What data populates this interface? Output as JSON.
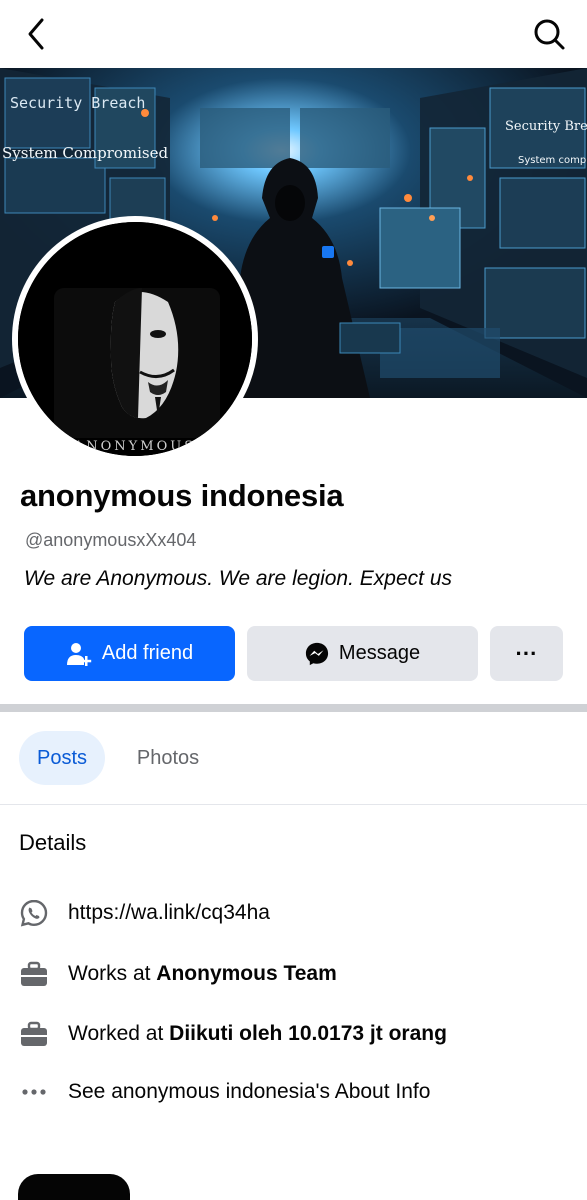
{
  "header": {
    "back_icon": "chevron-left-icon",
    "search_icon": "search-icon"
  },
  "cover": {
    "overlay_texts": [
      "Security Breach",
      "System Compromised",
      "Security Breach",
      "System compromised"
    ]
  },
  "avatar": {
    "mask_text": "ANONYMOUS"
  },
  "profile": {
    "name": "anonymous indonesia",
    "handle": "@anonymousxXx404",
    "bio": "We are Anonymous. We are legion. Expect us"
  },
  "actions": {
    "add_friend": "Add friend",
    "message": "Message",
    "more": "···"
  },
  "tabs": [
    {
      "label": "Posts",
      "active": true
    },
    {
      "label": "Photos",
      "active": false
    }
  ],
  "details": {
    "title": "Details",
    "items": [
      {
        "icon": "whatsapp-icon",
        "text": "https://wa.link/cq34ha"
      },
      {
        "icon": "briefcase-icon",
        "prefix": "Works at ",
        "bold": "Anonymous Team"
      },
      {
        "icon": "briefcase-icon",
        "prefix": "Worked at ",
        "bold": "Diikuti oleh 10.0173 jt orang"
      },
      {
        "icon": "more-dots-icon",
        "text": "See anonymous indonesia's About Info"
      }
    ]
  },
  "colors": {
    "primary": "#0866ff",
    "secondary_button": "#e4e6eb",
    "tab_active_bg": "#e7f1fd",
    "link": "#1a5fb4"
  }
}
